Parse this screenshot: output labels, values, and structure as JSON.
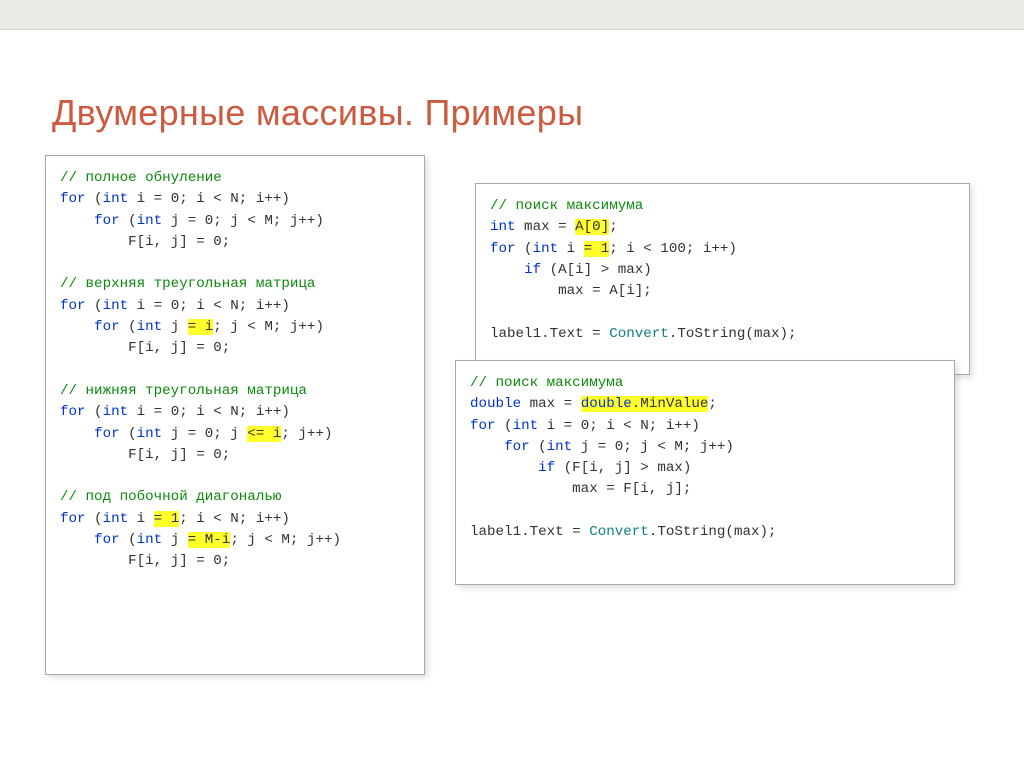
{
  "title": "Двумерные массивы. Примеры",
  "left": {
    "c1": "// полное обнуление",
    "l1_a": "for",
    "l1_b": "int",
    "l1_c": " i = 0; i < N; i++)",
    "l2_a": "for",
    "l2_b": "int",
    "l2_c": " j = 0; j < M; j++)",
    "l3": "        F[i, j] = 0;",
    "c2": "// верхняя треугольная матрица",
    "l4_a": "for",
    "l4_b": "int",
    "l4_c": " i = 0; i < N; i++)",
    "l5_a": "for",
    "l5_b": "int",
    "l5_h": "= i",
    "l5_c": "; j < M; j++)",
    "l6": "        F[i, j] = 0;",
    "c3": "// нижняя треугольная матрица",
    "l7_a": "for",
    "l7_b": "int",
    "l7_c": " i = 0; i < N; i++)",
    "l8_a": "for",
    "l8_b": "int",
    "l8_c": " j = 0; j ",
    "l8_h": "<= i",
    "l8_d": "; j++)",
    "l9": "        F[i, j] = 0;",
    "c4": "// под побочной диагональю",
    "l10_a": "for",
    "l10_b": "int",
    "l10_h": "= 1",
    "l10_c": "; i < N; i++)",
    "l11_a": "for",
    "l11_b": "int",
    "l11_h": "= M-i",
    "l11_c": "; j < M; j++)",
    "l12": "        F[i, j] = 0;"
  },
  "topbox": {
    "c1": "// поиск максимума",
    "l1_a": "int",
    "l1_b": " max = ",
    "l1_h": "A[0]",
    "l2_a": "for",
    "l2_b": "int",
    "l2_h": "= 1",
    "l2_c": "; i < 100; i++)",
    "l3_a": "if",
    "l3_b": " (A[i] > max)",
    "l4": "        max = A[i];",
    "l5_a": "label1.Text = ",
    "l5_b": "Convert",
    "l5_c": ".ToString(max);"
  },
  "botbox": {
    "c1": "// поиск максимума",
    "l1_a": "double",
    "l1_b": " max = ",
    "l1_c": "double",
    "l1_h": ".MinValue",
    "l2_a": "for",
    "l2_b": "int",
    "l2_c": " i = 0; i < N; i++)",
    "l3_a": "for",
    "l3_b": "int",
    "l3_c": " j = 0; j < M; j++)",
    "l4_a": "if",
    "l4_b": " (F[i, j] > max)",
    "l5": "            max = F[i, j];",
    "l6_a": "label1.Text = ",
    "l6_b": "Convert",
    "l6_c": ".ToString(max);"
  }
}
